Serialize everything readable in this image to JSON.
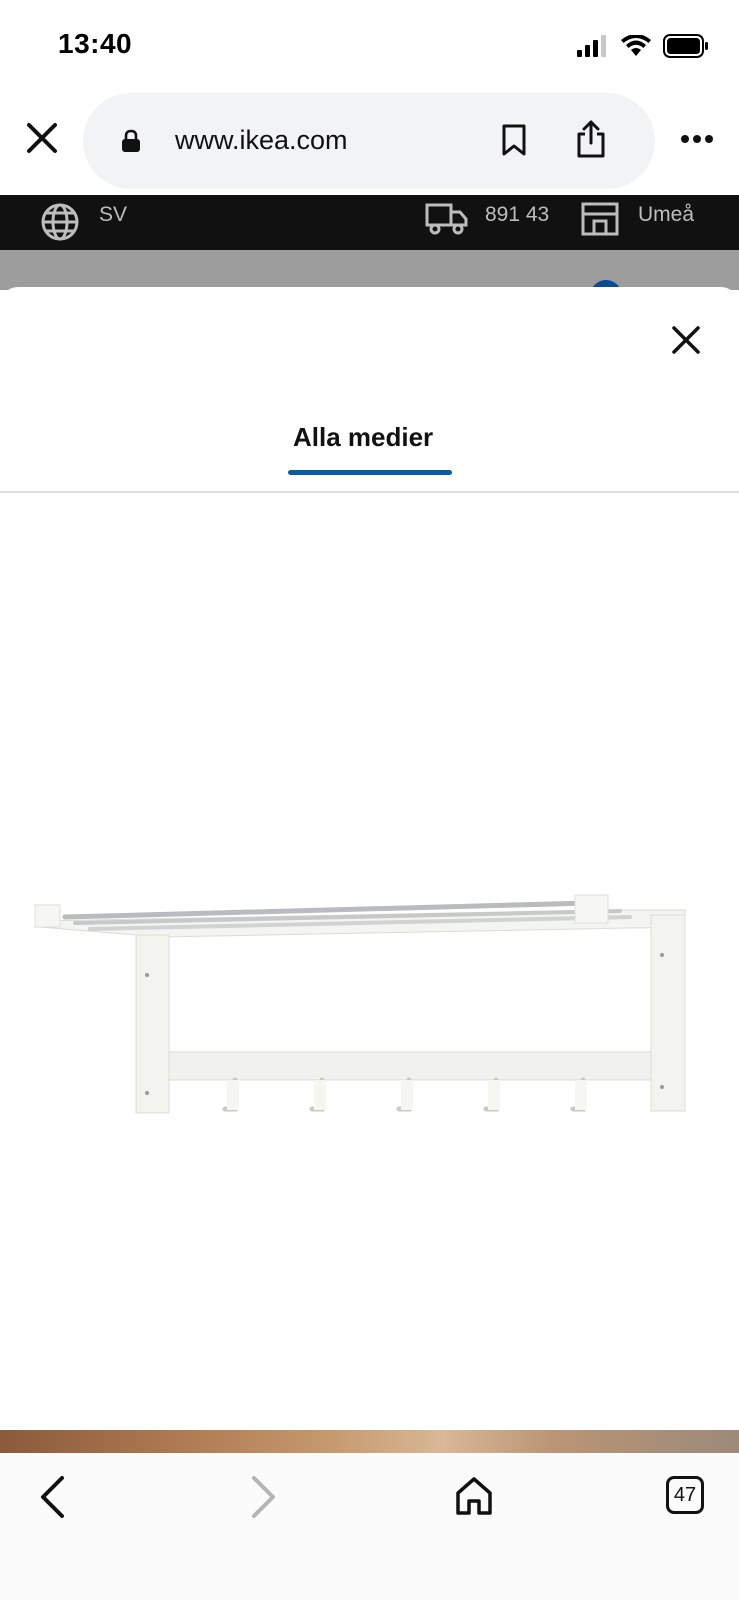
{
  "status_bar": {
    "time": "13:40"
  },
  "browser": {
    "url": "www.ikea.com"
  },
  "ikea_header": {
    "language": "SV",
    "postal_code": "891 43",
    "store": "Umeå"
  },
  "modal": {
    "tab_label": "Alla medier"
  },
  "toolbar": {
    "tab_count": "47"
  }
}
